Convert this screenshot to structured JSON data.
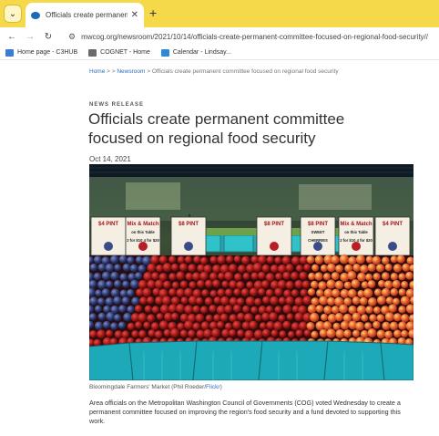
{
  "browser": {
    "tab_title": "Officials create permanent com",
    "url": "mwcog.org/newsroom/2021/10/14/officials-create-permanent-committee-focused-on-regional-food-security//",
    "bookmarks": [
      {
        "label": "Home page - C3HUB",
        "color": "#3b7bd6"
      },
      {
        "label": "COGNET - Home",
        "color": "#6a6a6a"
      },
      {
        "label": "Calendar - Lindsay...",
        "color": "#2d89d6"
      }
    ]
  },
  "page": {
    "breadcrumb_home": "Home",
    "breadcrumb_sep1": " >  > ",
    "breadcrumb_newsroom": "Newsroom",
    "breadcrumb_rest": " > Officials create permanent committee focused on regional food security",
    "kicker": "NEWS RELEASE",
    "headline": "Officials create permanent committee focused on regional food security",
    "date": "Oct 14, 2021",
    "photo_signs": [
      {
        "price": "$4 PINT",
        "line1": "",
        "line2": ""
      },
      {
        "price": "Mix & Match",
        "line1": "on this Table",
        "line2": "2 for $10  4 for $20"
      },
      {
        "price": "$8 PINT",
        "line1": "",
        "line2": ""
      },
      {
        "price": "$8 PINT",
        "line1": "",
        "line2": ""
      },
      {
        "price": "$8 PINT",
        "line1": "SWEET",
        "line2": "CHERRIES"
      },
      {
        "price": "Mix & Match",
        "line1": "on this Table",
        "line2": "2 for $10  4 for $20"
      },
      {
        "price": "$4 PINT",
        "line1": "",
        "line2": ""
      }
    ],
    "caption_text": "Bloomingdale Farmers' Market (Phil Roeder/",
    "caption_link": "Flickr",
    "caption_end": ")",
    "body": "Area officials on the Metropolitan Washington Council of Governments (COG) voted Wednesday to create a permanent committee focused on improving the region's food security and a fund devoted to supporting this work."
  }
}
